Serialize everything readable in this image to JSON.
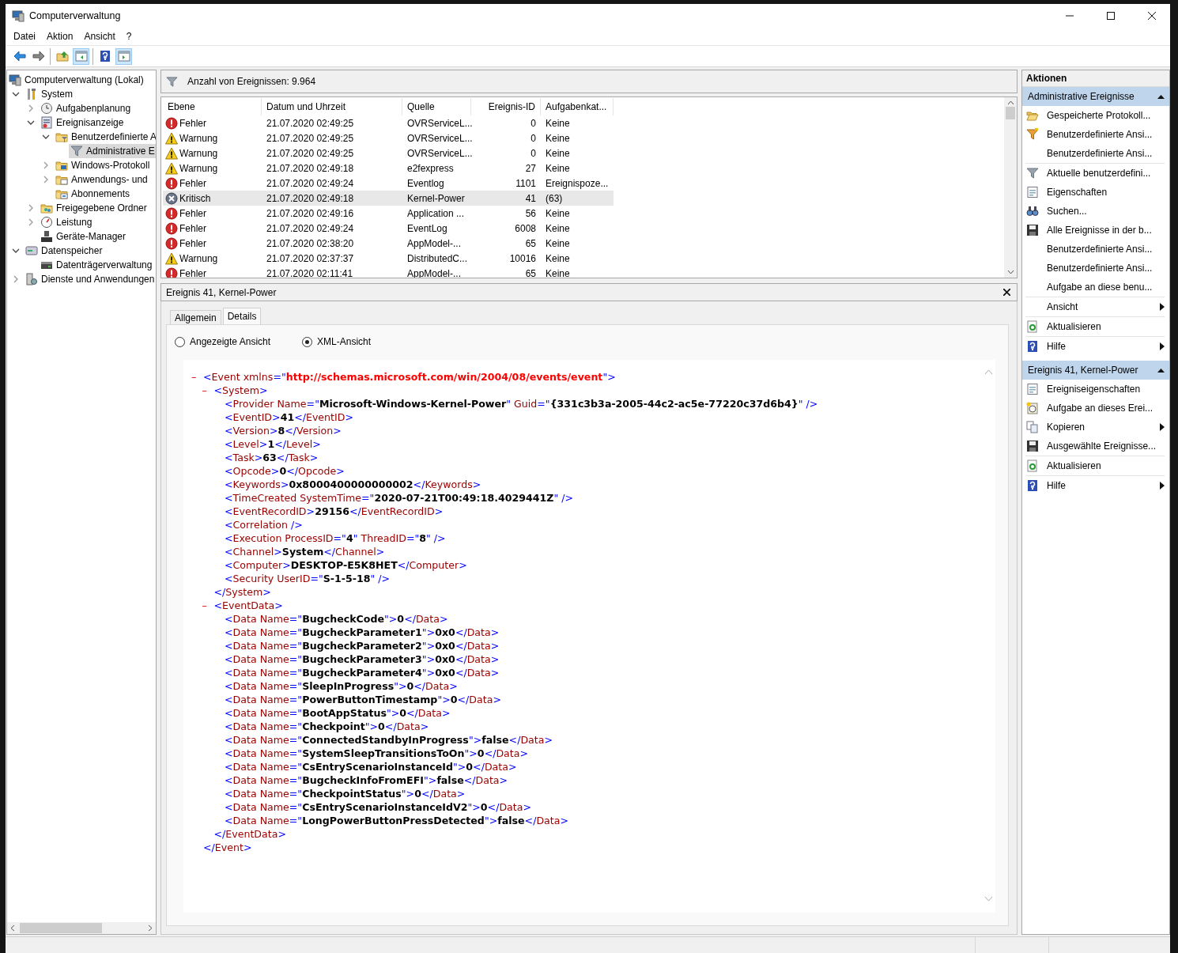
{
  "window": {
    "title": "Computerverwaltung"
  },
  "menu": [
    "Datei",
    "Aktion",
    "Ansicht",
    "?"
  ],
  "toolbar": [
    [
      {
        "kind": "back",
        "pressed": false
      },
      {
        "kind": "forward",
        "pressed": false
      }
    ],
    [
      {
        "kind": "up",
        "pressed": false
      },
      {
        "kind": "tree",
        "pressed": true
      }
    ],
    [
      {
        "kind": "help",
        "pressed": false
      },
      {
        "kind": "pane",
        "pressed": true
      }
    ]
  ],
  "tree": [
    {
      "label": "Computerverwaltung (Lokal)",
      "kind": "computer",
      "selected": false,
      "children": [
        {
          "label": "System",
          "kind": "tools",
          "expanded": true,
          "selected": false,
          "children": [
            {
              "label": "Aufgabenplanung",
              "kind": "clock",
              "expanded": false,
              "selected": false
            },
            {
              "label": "Ereignisanzeige",
              "kind": "viewer",
              "expanded": true,
              "selected": false,
              "children": [
                {
                  "label": "Benutzerdefinierte A",
                  "kind": "filterfolder",
                  "expanded": true,
                  "selected": false,
                  "children": [
                    {
                      "label": "Administrative E",
                      "kind": "filter",
                      "selected": true
                    }
                  ]
                },
                {
                  "label": "Windows-Protokoll",
                  "kind": "logsfolder",
                  "expanded": false,
                  "selected": false
                },
                {
                  "label": "Anwendungs- und",
                  "kind": "appfolder",
                  "expanded": false,
                  "selected": false
                },
                {
                  "label": "Abonnements",
                  "kind": "subfolder",
                  "selected": false
                }
              ]
            },
            {
              "label": "Freigegebene Ordner",
              "kind": "share",
              "expanded": false,
              "selected": false
            },
            {
              "label": "Leistung",
              "kind": "gauge",
              "expanded": false,
              "selected": false
            },
            {
              "label": "Geräte-Manager",
              "kind": "device",
              "selected": false
            }
          ]
        },
        {
          "label": "Datenspeicher",
          "kind": "storage",
          "expanded": true,
          "selected": false,
          "children": [
            {
              "label": "Datenträgerverwaltung",
              "kind": "disk",
              "selected": false
            }
          ]
        },
        {
          "label": "Dienste und Anwendungen",
          "kind": "services",
          "expanded": false,
          "selected": false
        }
      ]
    }
  ],
  "events": {
    "count_label": "Anzahl von Ereignissen: 9.964",
    "columns": [
      "Ebene",
      "Datum und Uhrzeit",
      "Quelle",
      "Ereignis-ID",
      "Aufgabenkat..."
    ],
    "rows": [
      {
        "kind": "error",
        "selected": false,
        "cells": [
          "Fehler",
          "21.07.2020 02:49:25",
          "OVRServiceL...",
          "0",
          "Keine"
        ]
      },
      {
        "kind": "warning",
        "selected": false,
        "cells": [
          "Warnung",
          "21.07.2020 02:49:25",
          "OVRServiceL...",
          "0",
          "Keine"
        ]
      },
      {
        "kind": "warning",
        "selected": false,
        "cells": [
          "Warnung",
          "21.07.2020 02:49:25",
          "OVRServiceL...",
          "0",
          "Keine"
        ]
      },
      {
        "kind": "warning",
        "selected": false,
        "cells": [
          "Warnung",
          "21.07.2020 02:49:18",
          "e2fexpress",
          "27",
          "Keine"
        ]
      },
      {
        "kind": "error",
        "selected": false,
        "cells": [
          "Fehler",
          "21.07.2020 02:49:24",
          "Eventlog",
          "1101",
          "Ereignispoze..."
        ]
      },
      {
        "kind": "critical",
        "selected": true,
        "cells": [
          "Kritisch",
          "21.07.2020 02:49:18",
          "Kernel-Power",
          "41",
          "(63)"
        ]
      },
      {
        "kind": "error",
        "selected": false,
        "cells": [
          "Fehler",
          "21.07.2020 02:49:16",
          "Application ...",
          "56",
          "Keine"
        ]
      },
      {
        "kind": "error",
        "selected": false,
        "cells": [
          "Fehler",
          "21.07.2020 02:49:24",
          "EventLog",
          "6008",
          "Keine"
        ]
      },
      {
        "kind": "error",
        "selected": false,
        "cells": [
          "Fehler",
          "21.07.2020 02:38:20",
          "AppModel-...",
          "65",
          "Keine"
        ]
      },
      {
        "kind": "warning",
        "selected": false,
        "cells": [
          "Warnung",
          "21.07.2020 02:37:37",
          "DistributedC...",
          "10016",
          "Keine"
        ]
      },
      {
        "kind": "error",
        "selected": false,
        "cells": [
          "Fehler",
          "21.07.2020 02:11:41",
          "AppModel-...",
          "65",
          "Keine"
        ]
      }
    ]
  },
  "detail": {
    "title": "Ereignis 41, Kernel-Power",
    "tabs": [
      {
        "label": "Allgemein",
        "selected": false
      },
      {
        "label": "Details",
        "selected": true
      }
    ],
    "views": [
      {
        "label": "Angezeigte Ansicht",
        "selected": false
      },
      {
        "label": "XML-Ansicht",
        "selected": true
      }
    ],
    "xml": {
      "toggle": "–",
      "open": [
        {
          "kind": "punct",
          "text": "<"
        },
        {
          "kind": "name",
          "text": "Event xmlns"
        },
        {
          "kind": "punct",
          "text": "=\""
        },
        {
          "kind": "url",
          "text": "http://schemas.microsoft.com/win/2004/08/events/event"
        },
        {
          "kind": "punct",
          "text": "\">"
        }
      ],
      "close": [
        {
          "kind": "punct",
          "text": "</"
        },
        {
          "kind": "name",
          "text": "Event"
        },
        {
          "kind": "punct",
          "text": ">"
        }
      ],
      "children": [
        {
          "toggle": "–",
          "open": [
            {
              "kind": "punct",
              "text": "<"
            },
            {
              "kind": "name",
              "text": "System"
            },
            {
              "kind": "punct",
              "text": ">"
            }
          ],
          "close": [
            {
              "kind": "punct",
              "text": "</"
            },
            {
              "kind": "name",
              "text": "System"
            },
            {
              "kind": "punct",
              "text": ">"
            }
          ],
          "children": [
            {
              "segments": [
                {
                  "kind": "punct",
                  "text": "<"
                },
                {
                  "kind": "name",
                  "text": "Provider Name"
                },
                {
                  "kind": "punct",
                  "text": "=\""
                },
                {
                  "kind": "value",
                  "text": "Microsoft-Windows-Kernel-Power"
                },
                {
                  "kind": "punct",
                  "text": "\" "
                },
                {
                  "kind": "name",
                  "text": "Guid"
                },
                {
                  "kind": "punct",
                  "text": "=\""
                },
                {
                  "kind": "value",
                  "text": "{331c3b3a-2005-44c2-ac5e-77220c37d6b4}"
                },
                {
                  "kind": "punct",
                  "text": "\" />"
                }
              ]
            },
            {
              "segments": [
                {
                  "kind": "punct",
                  "text": "<"
                },
                {
                  "kind": "name",
                  "text": "EventID"
                },
                {
                  "kind": "punct",
                  "text": ">"
                },
                {
                  "kind": "value",
                  "text": "41"
                },
                {
                  "kind": "punct",
                  "text": "</"
                },
                {
                  "kind": "name",
                  "text": "EventID"
                },
                {
                  "kind": "punct",
                  "text": ">"
                }
              ]
            },
            {
              "segments": [
                {
                  "kind": "punct",
                  "text": "<"
                },
                {
                  "kind": "name",
                  "text": "Version"
                },
                {
                  "kind": "punct",
                  "text": ">"
                },
                {
                  "kind": "value",
                  "text": "8"
                },
                {
                  "kind": "punct",
                  "text": "</"
                },
                {
                  "kind": "name",
                  "text": "Version"
                },
                {
                  "kind": "punct",
                  "text": ">"
                }
              ]
            },
            {
              "segments": [
                {
                  "kind": "punct",
                  "text": "<"
                },
                {
                  "kind": "name",
                  "text": "Level"
                },
                {
                  "kind": "punct",
                  "text": ">"
                },
                {
                  "kind": "value",
                  "text": "1"
                },
                {
                  "kind": "punct",
                  "text": "</"
                },
                {
                  "kind": "name",
                  "text": "Level"
                },
                {
                  "kind": "punct",
                  "text": ">"
                }
              ]
            },
            {
              "segments": [
                {
                  "kind": "punct",
                  "text": "<"
                },
                {
                  "kind": "name",
                  "text": "Task"
                },
                {
                  "kind": "punct",
                  "text": ">"
                },
                {
                  "kind": "value",
                  "text": "63"
                },
                {
                  "kind": "punct",
                  "text": "</"
                },
                {
                  "kind": "name",
                  "text": "Task"
                },
                {
                  "kind": "punct",
                  "text": ">"
                }
              ]
            },
            {
              "segments": [
                {
                  "kind": "punct",
                  "text": "<"
                },
                {
                  "kind": "name",
                  "text": "Opcode"
                },
                {
                  "kind": "punct",
                  "text": ">"
                },
                {
                  "kind": "value",
                  "text": "0"
                },
                {
                  "kind": "punct",
                  "text": "</"
                },
                {
                  "kind": "name",
                  "text": "Opcode"
                },
                {
                  "kind": "punct",
                  "text": ">"
                }
              ]
            },
            {
              "segments": [
                {
                  "kind": "punct",
                  "text": "<"
                },
                {
                  "kind": "name",
                  "text": "Keywords"
                },
                {
                  "kind": "punct",
                  "text": ">"
                },
                {
                  "kind": "value",
                  "text": "0x8000400000000002"
                },
                {
                  "kind": "punct",
                  "text": "</"
                },
                {
                  "kind": "name",
                  "text": "Keywords"
                },
                {
                  "kind": "punct",
                  "text": ">"
                }
              ]
            },
            {
              "segments": [
                {
                  "kind": "punct",
                  "text": "<"
                },
                {
                  "kind": "name",
                  "text": "TimeCreated SystemTime"
                },
                {
                  "kind": "punct",
                  "text": "=\""
                },
                {
                  "kind": "value",
                  "text": "2020-07-21T00:49:18.4029441Z"
                },
                {
                  "kind": "punct",
                  "text": "\" />"
                }
              ]
            },
            {
              "segments": [
                {
                  "kind": "punct",
                  "text": "<"
                },
                {
                  "kind": "name",
                  "text": "EventRecordID"
                },
                {
                  "kind": "punct",
                  "text": ">"
                },
                {
                  "kind": "value",
                  "text": "29156"
                },
                {
                  "kind": "punct",
                  "text": "</"
                },
                {
                  "kind": "name",
                  "text": "EventRecordID"
                },
                {
                  "kind": "punct",
                  "text": ">"
                }
              ]
            },
            {
              "segments": [
                {
                  "kind": "punct",
                  "text": "<"
                },
                {
                  "kind": "name",
                  "text": "Correlation"
                },
                {
                  "kind": "punct",
                  "text": " />"
                }
              ]
            },
            {
              "segments": [
                {
                  "kind": "punct",
                  "text": "<"
                },
                {
                  "kind": "name",
                  "text": "Execution ProcessID"
                },
                {
                  "kind": "punct",
                  "text": "=\""
                },
                {
                  "kind": "value",
                  "text": "4"
                },
                {
                  "kind": "punct",
                  "text": "\" "
                },
                {
                  "kind": "name",
                  "text": "ThreadID"
                },
                {
                  "kind": "punct",
                  "text": "=\""
                },
                {
                  "kind": "value",
                  "text": "8"
                },
                {
                  "kind": "punct",
                  "text": "\" />"
                }
              ]
            },
            {
              "segments": [
                {
                  "kind": "punct",
                  "text": "<"
                },
                {
                  "kind": "name",
                  "text": "Channel"
                },
                {
                  "kind": "punct",
                  "text": ">"
                },
                {
                  "kind": "value",
                  "text": "System"
                },
                {
                  "kind": "punct",
                  "text": "</"
                },
                {
                  "kind": "name",
                  "text": "Channel"
                },
                {
                  "kind": "punct",
                  "text": ">"
                }
              ]
            },
            {
              "segments": [
                {
                  "kind": "punct",
                  "text": "<"
                },
                {
                  "kind": "name",
                  "text": "Computer"
                },
                {
                  "kind": "punct",
                  "text": ">"
                },
                {
                  "kind": "value",
                  "text": "DESKTOP-E5K8HET"
                },
                {
                  "kind": "punct",
                  "text": "</"
                },
                {
                  "kind": "name",
                  "text": "Computer"
                },
                {
                  "kind": "punct",
                  "text": ">"
                }
              ]
            },
            {
              "segments": [
                {
                  "kind": "punct",
                  "text": "<"
                },
                {
                  "kind": "name",
                  "text": "Security UserID"
                },
                {
                  "kind": "punct",
                  "text": "=\""
                },
                {
                  "kind": "value",
                  "text": "S-1-5-18"
                },
                {
                  "kind": "punct",
                  "text": "\" />"
                }
              ]
            }
          ]
        },
        {
          "toggle": "–",
          "open": [
            {
              "kind": "punct",
              "text": "<"
            },
            {
              "kind": "name",
              "text": "EventData"
            },
            {
              "kind": "punct",
              "text": ">"
            }
          ],
          "close": [
            {
              "kind": "punct",
              "text": "</"
            },
            {
              "kind": "name",
              "text": "EventData"
            },
            {
              "kind": "punct",
              "text": ">"
            }
          ],
          "children": [
            {
              "segments": [
                {
                  "kind": "punct",
                  "text": "<"
                },
                {
                  "kind": "name",
                  "text": "Data Name"
                },
                {
                  "kind": "punct",
                  "text": "=\""
                },
                {
                  "kind": "value",
                  "text": "BugcheckCode"
                },
                {
                  "kind": "punct",
                  "text": "\">"
                },
                {
                  "kind": "value",
                  "text": "0"
                },
                {
                  "kind": "punct",
                  "text": "</"
                },
                {
                  "kind": "name",
                  "text": "Data"
                },
                {
                  "kind": "punct",
                  "text": ">"
                }
              ]
            },
            {
              "segments": [
                {
                  "kind": "punct",
                  "text": "<"
                },
                {
                  "kind": "name",
                  "text": "Data Name"
                },
                {
                  "kind": "punct",
                  "text": "=\""
                },
                {
                  "kind": "value",
                  "text": "BugcheckParameter1"
                },
                {
                  "kind": "punct",
                  "text": "\">"
                },
                {
                  "kind": "value",
                  "text": "0x0"
                },
                {
                  "kind": "punct",
                  "text": "</"
                },
                {
                  "kind": "name",
                  "text": "Data"
                },
                {
                  "kind": "punct",
                  "text": ">"
                }
              ]
            },
            {
              "segments": [
                {
                  "kind": "punct",
                  "text": "<"
                },
                {
                  "kind": "name",
                  "text": "Data Name"
                },
                {
                  "kind": "punct",
                  "text": "=\""
                },
                {
                  "kind": "value",
                  "text": "BugcheckParameter2"
                },
                {
                  "kind": "punct",
                  "text": "\">"
                },
                {
                  "kind": "value",
                  "text": "0x0"
                },
                {
                  "kind": "punct",
                  "text": "</"
                },
                {
                  "kind": "name",
                  "text": "Data"
                },
                {
                  "kind": "punct",
                  "text": ">"
                }
              ]
            },
            {
              "segments": [
                {
                  "kind": "punct",
                  "text": "<"
                },
                {
                  "kind": "name",
                  "text": "Data Name"
                },
                {
                  "kind": "punct",
                  "text": "=\""
                },
                {
                  "kind": "value",
                  "text": "BugcheckParameter3"
                },
                {
                  "kind": "punct",
                  "text": "\">"
                },
                {
                  "kind": "value",
                  "text": "0x0"
                },
                {
                  "kind": "punct",
                  "text": "</"
                },
                {
                  "kind": "name",
                  "text": "Data"
                },
                {
                  "kind": "punct",
                  "text": ">"
                }
              ]
            },
            {
              "segments": [
                {
                  "kind": "punct",
                  "text": "<"
                },
                {
                  "kind": "name",
                  "text": "Data Name"
                },
                {
                  "kind": "punct",
                  "text": "=\""
                },
                {
                  "kind": "value",
                  "text": "BugcheckParameter4"
                },
                {
                  "kind": "punct",
                  "text": "\">"
                },
                {
                  "kind": "value",
                  "text": "0x0"
                },
                {
                  "kind": "punct",
                  "text": "</"
                },
                {
                  "kind": "name",
                  "text": "Data"
                },
                {
                  "kind": "punct",
                  "text": ">"
                }
              ]
            },
            {
              "segments": [
                {
                  "kind": "punct",
                  "text": "<"
                },
                {
                  "kind": "name",
                  "text": "Data Name"
                },
                {
                  "kind": "punct",
                  "text": "=\""
                },
                {
                  "kind": "value",
                  "text": "SleepInProgress"
                },
                {
                  "kind": "punct",
                  "text": "\">"
                },
                {
                  "kind": "value",
                  "text": "0"
                },
                {
                  "kind": "punct",
                  "text": "</"
                },
                {
                  "kind": "name",
                  "text": "Data"
                },
                {
                  "kind": "punct",
                  "text": ">"
                }
              ]
            },
            {
              "segments": [
                {
                  "kind": "punct",
                  "text": "<"
                },
                {
                  "kind": "name",
                  "text": "Data Name"
                },
                {
                  "kind": "punct",
                  "text": "=\""
                },
                {
                  "kind": "value",
                  "text": "PowerButtonTimestamp"
                },
                {
                  "kind": "punct",
                  "text": "\">"
                },
                {
                  "kind": "value",
                  "text": "0"
                },
                {
                  "kind": "punct",
                  "text": "</"
                },
                {
                  "kind": "name",
                  "text": "Data"
                },
                {
                  "kind": "punct",
                  "text": ">"
                }
              ]
            },
            {
              "segments": [
                {
                  "kind": "punct",
                  "text": "<"
                },
                {
                  "kind": "name",
                  "text": "Data Name"
                },
                {
                  "kind": "punct",
                  "text": "=\""
                },
                {
                  "kind": "value",
                  "text": "BootAppStatus"
                },
                {
                  "kind": "punct",
                  "text": "\">"
                },
                {
                  "kind": "value",
                  "text": "0"
                },
                {
                  "kind": "punct",
                  "text": "</"
                },
                {
                  "kind": "name",
                  "text": "Data"
                },
                {
                  "kind": "punct",
                  "text": ">"
                }
              ]
            },
            {
              "segments": [
                {
                  "kind": "punct",
                  "text": "<"
                },
                {
                  "kind": "name",
                  "text": "Data Name"
                },
                {
                  "kind": "punct",
                  "text": "=\""
                },
                {
                  "kind": "value",
                  "text": "Checkpoint"
                },
                {
                  "kind": "punct",
                  "text": "\">"
                },
                {
                  "kind": "value",
                  "text": "0"
                },
                {
                  "kind": "punct",
                  "text": "</"
                },
                {
                  "kind": "name",
                  "text": "Data"
                },
                {
                  "kind": "punct",
                  "text": ">"
                }
              ]
            },
            {
              "segments": [
                {
                  "kind": "punct",
                  "text": "<"
                },
                {
                  "kind": "name",
                  "text": "Data Name"
                },
                {
                  "kind": "punct",
                  "text": "=\""
                },
                {
                  "kind": "value",
                  "text": "ConnectedStandbyInProgress"
                },
                {
                  "kind": "punct",
                  "text": "\">"
                },
                {
                  "kind": "value",
                  "text": "false"
                },
                {
                  "kind": "punct",
                  "text": "</"
                },
                {
                  "kind": "name",
                  "text": "Data"
                },
                {
                  "kind": "punct",
                  "text": ">"
                }
              ]
            },
            {
              "segments": [
                {
                  "kind": "punct",
                  "text": "<"
                },
                {
                  "kind": "name",
                  "text": "Data Name"
                },
                {
                  "kind": "punct",
                  "text": "=\""
                },
                {
                  "kind": "value",
                  "text": "SystemSleepTransitionsToOn"
                },
                {
                  "kind": "punct",
                  "text": "\">"
                },
                {
                  "kind": "value",
                  "text": "0"
                },
                {
                  "kind": "punct",
                  "text": "</"
                },
                {
                  "kind": "name",
                  "text": "Data"
                },
                {
                  "kind": "punct",
                  "text": ">"
                }
              ]
            },
            {
              "segments": [
                {
                  "kind": "punct",
                  "text": "<"
                },
                {
                  "kind": "name",
                  "text": "Data Name"
                },
                {
                  "kind": "punct",
                  "text": "=\""
                },
                {
                  "kind": "value",
                  "text": "CsEntryScenarioInstanceId"
                },
                {
                  "kind": "punct",
                  "text": "\">"
                },
                {
                  "kind": "value",
                  "text": "0"
                },
                {
                  "kind": "punct",
                  "text": "</"
                },
                {
                  "kind": "name",
                  "text": "Data"
                },
                {
                  "kind": "punct",
                  "text": ">"
                }
              ]
            },
            {
              "segments": [
                {
                  "kind": "punct",
                  "text": "<"
                },
                {
                  "kind": "name",
                  "text": "Data Name"
                },
                {
                  "kind": "punct",
                  "text": "=\""
                },
                {
                  "kind": "value",
                  "text": "BugcheckInfoFromEFI"
                },
                {
                  "kind": "punct",
                  "text": "\">"
                },
                {
                  "kind": "value",
                  "text": "false"
                },
                {
                  "kind": "punct",
                  "text": "</"
                },
                {
                  "kind": "name",
                  "text": "Data"
                },
                {
                  "kind": "punct",
                  "text": ">"
                }
              ]
            },
            {
              "segments": [
                {
                  "kind": "punct",
                  "text": "<"
                },
                {
                  "kind": "name",
                  "text": "Data Name"
                },
                {
                  "kind": "punct",
                  "text": "=\""
                },
                {
                  "kind": "value",
                  "text": "CheckpointStatus"
                },
                {
                  "kind": "punct",
                  "text": "\">"
                },
                {
                  "kind": "value",
                  "text": "0"
                },
                {
                  "kind": "punct",
                  "text": "</"
                },
                {
                  "kind": "name",
                  "text": "Data"
                },
                {
                  "kind": "punct",
                  "text": ">"
                }
              ]
            },
            {
              "segments": [
                {
                  "kind": "punct",
                  "text": "<"
                },
                {
                  "kind": "name",
                  "text": "Data Name"
                },
                {
                  "kind": "punct",
                  "text": "=\""
                },
                {
                  "kind": "value",
                  "text": "CsEntryScenarioInstanceIdV2"
                },
                {
                  "kind": "punct",
                  "text": "\">"
                },
                {
                  "kind": "value",
                  "text": "0"
                },
                {
                  "kind": "punct",
                  "text": "</"
                },
                {
                  "kind": "name",
                  "text": "Data"
                },
                {
                  "kind": "punct",
                  "text": ">"
                }
              ]
            },
            {
              "segments": [
                {
                  "kind": "punct",
                  "text": "<"
                },
                {
                  "kind": "name",
                  "text": "Data Name"
                },
                {
                  "kind": "punct",
                  "text": "=\""
                },
                {
                  "kind": "value",
                  "text": "LongPowerButtonPressDetected"
                },
                {
                  "kind": "punct",
                  "text": "\">"
                },
                {
                  "kind": "value",
                  "text": "false"
                },
                {
                  "kind": "punct",
                  "text": "</"
                },
                {
                  "kind": "name",
                  "text": "Data"
                },
                {
                  "kind": "punct",
                  "text": ">"
                }
              ]
            }
          ]
        }
      ]
    }
  },
  "actions": {
    "title": "Aktionen",
    "sections": [
      {
        "title": "Administrative Ereignisse",
        "expanded": true,
        "groups": [
          [
            {
              "label": "Gespeicherte Protokoll...",
              "kind": "open",
              "submenu": false
            },
            {
              "label": "Benutzerdefinierte Ansi...",
              "kind": "newfilter",
              "submenu": false
            },
            {
              "label": "Benutzerdefinierte Ansi...",
              "kind": "none",
              "submenu": false
            }
          ],
          [
            {
              "label": "Aktuelle benutzerdefini...",
              "kind": "filter",
              "submenu": false
            },
            {
              "label": "Eigenschaften",
              "kind": "properties",
              "submenu": false
            },
            {
              "label": "Suchen...",
              "kind": "find",
              "submenu": false
            },
            {
              "label": "Alle Ereignisse in der b...",
              "kind": "save",
              "submenu": false
            },
            {
              "label": "Benutzerdefinierte Ansi...",
              "kind": "none",
              "submenu": false
            },
            {
              "label": "Benutzerdefinierte Ansi...",
              "kind": "none",
              "submenu": false
            },
            {
              "label": "Aufgabe an diese benu...",
              "kind": "none",
              "submenu": false
            }
          ],
          [
            {
              "label": "Ansicht",
              "kind": "none",
              "submenu": true
            }
          ],
          [
            {
              "label": "Aktualisieren",
              "kind": "refresh",
              "submenu": false
            }
          ],
          [
            {
              "label": "Hilfe",
              "kind": "help",
              "submenu": true
            }
          ]
        ]
      },
      {
        "title": "Ereignis 41, Kernel-Power",
        "expanded": true,
        "groups": [
          [
            {
              "label": "Ereigniseigenschaften",
              "kind": "properties",
              "submenu": false
            },
            {
              "label": "Aufgabe an dieses Erei...",
              "kind": "task",
              "submenu": false
            },
            {
              "label": "Kopieren",
              "kind": "copy",
              "submenu": true
            },
            {
              "label": "Ausgewählte Ereignisse...",
              "kind": "save",
              "submenu": false
            }
          ],
          [
            {
              "label": "Aktualisieren",
              "kind": "refresh",
              "submenu": false
            }
          ],
          [
            {
              "label": "Hilfe",
              "kind": "help",
              "submenu": true
            }
          ]
        ]
      }
    ]
  }
}
